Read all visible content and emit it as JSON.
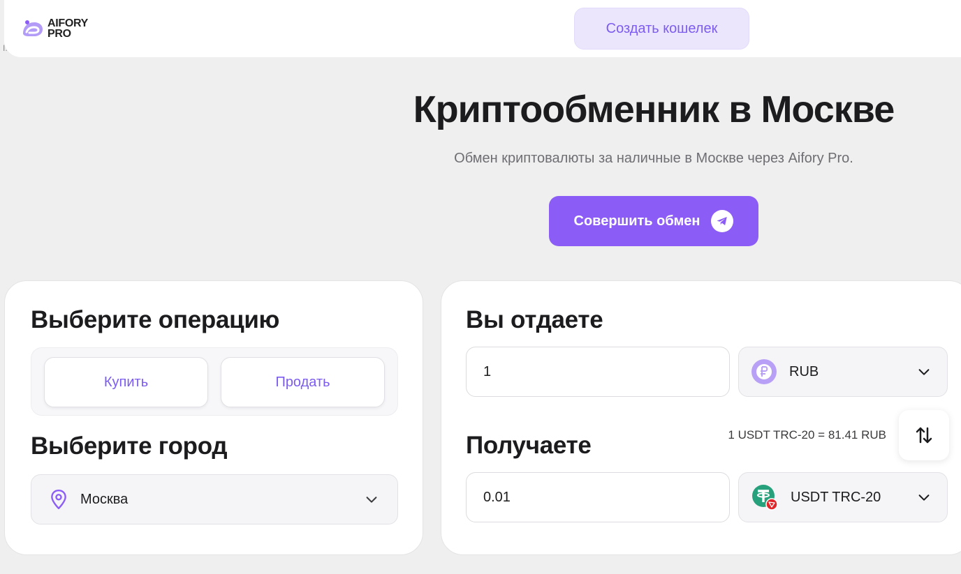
{
  "header": {
    "logo_line1": "AIFORY",
    "logo_line2": "PRO",
    "stray_mark": "I.",
    "create_wallet_label": "Создать кошелек"
  },
  "hero": {
    "title": "Криптообменник в Москве",
    "subtitle": "Обмен криптовалюты за наличные в Москве через Aifory Pro.",
    "exchange_button_label": "Совершить обмен"
  },
  "operation": {
    "title": "Выберите операцию",
    "buy_label": "Купить",
    "sell_label": "Продать"
  },
  "city": {
    "title": "Выберите город",
    "selected": "Москва"
  },
  "give": {
    "title": "Вы отдаете",
    "amount": "1",
    "currency": "RUB"
  },
  "receive": {
    "title": "Получаете",
    "amount": "0.01",
    "currency": "USDT TRC-20"
  },
  "rate_text": "1 USDT TRC-20 = 81.41 RUB",
  "colors": {
    "accent": "#8b5cf6",
    "accent_light": "#ece6fd",
    "tether_green": "#26a17b",
    "tron_red": "#e0262b",
    "ruble_badge": "#b9a0f7"
  }
}
